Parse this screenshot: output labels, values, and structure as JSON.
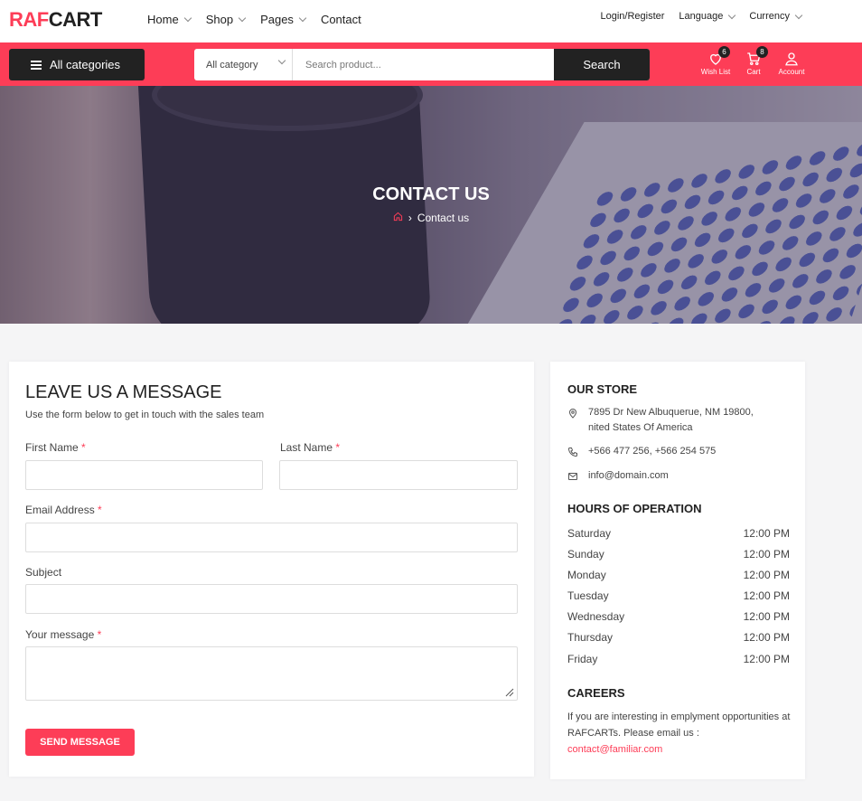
{
  "brand": {
    "part1": "RAF",
    "part2": "CART"
  },
  "nav": [
    {
      "label": "Home",
      "dropdown": true
    },
    {
      "label": "Shop",
      "dropdown": true
    },
    {
      "label": "Pages",
      "dropdown": true
    },
    {
      "label": "Contact",
      "dropdown": false
    }
  ],
  "top_right": {
    "login": "Login/Register",
    "language": "Language",
    "currency": "Currency"
  },
  "categories_button": "All categories",
  "search": {
    "category": "All category",
    "placeholder": "Search product...",
    "button": "Search"
  },
  "header_icons": {
    "wishlist": {
      "label": "Wish List",
      "count": "6"
    },
    "cart": {
      "label": "Cart",
      "count": "8"
    },
    "account": {
      "label": "Account"
    }
  },
  "hero": {
    "title": "CONTACT US",
    "breadcrumb_current": "Contact us"
  },
  "form": {
    "title": "LEAVE US A MESSAGE",
    "subtitle": "Use the form below to get in touch with the sales team",
    "first_name": "First Name",
    "last_name": "Last Name",
    "email": "Email Address",
    "subject": "Subject",
    "message": "Your message",
    "required_mark": "*",
    "send": "SEND MESSAGE"
  },
  "store": {
    "heading": "OUR STORE",
    "address_line1": "7895 Dr New Albuquerue, NM 19800,",
    "address_line2": "nited States Of America",
    "phone": "+566 477 256, +566 254 575",
    "email": "info@domain.com"
  },
  "hours": {
    "heading": "HOURS OF OPERATION",
    "rows": [
      {
        "day": "Saturday",
        "time": "12:00 PM"
      },
      {
        "day": "Sunday",
        "time": "12:00 PM"
      },
      {
        "day": "Monday",
        "time": "12:00 PM"
      },
      {
        "day": "Tuesday",
        "time": "12:00 PM"
      },
      {
        "day": "Wednesday",
        "time": "12:00 PM"
      },
      {
        "day": "Thursday",
        "time": "12:00 PM"
      },
      {
        "day": "Friday",
        "time": "12:00 PM"
      }
    ]
  },
  "careers": {
    "heading": "CAREERS",
    "text": "If you are interesting in emplyment opportunities at RAFCARTs. Please email us :",
    "email": "contact@familiar.com"
  },
  "colors": {
    "accent": "#fd3d57",
    "dark": "#222222"
  }
}
